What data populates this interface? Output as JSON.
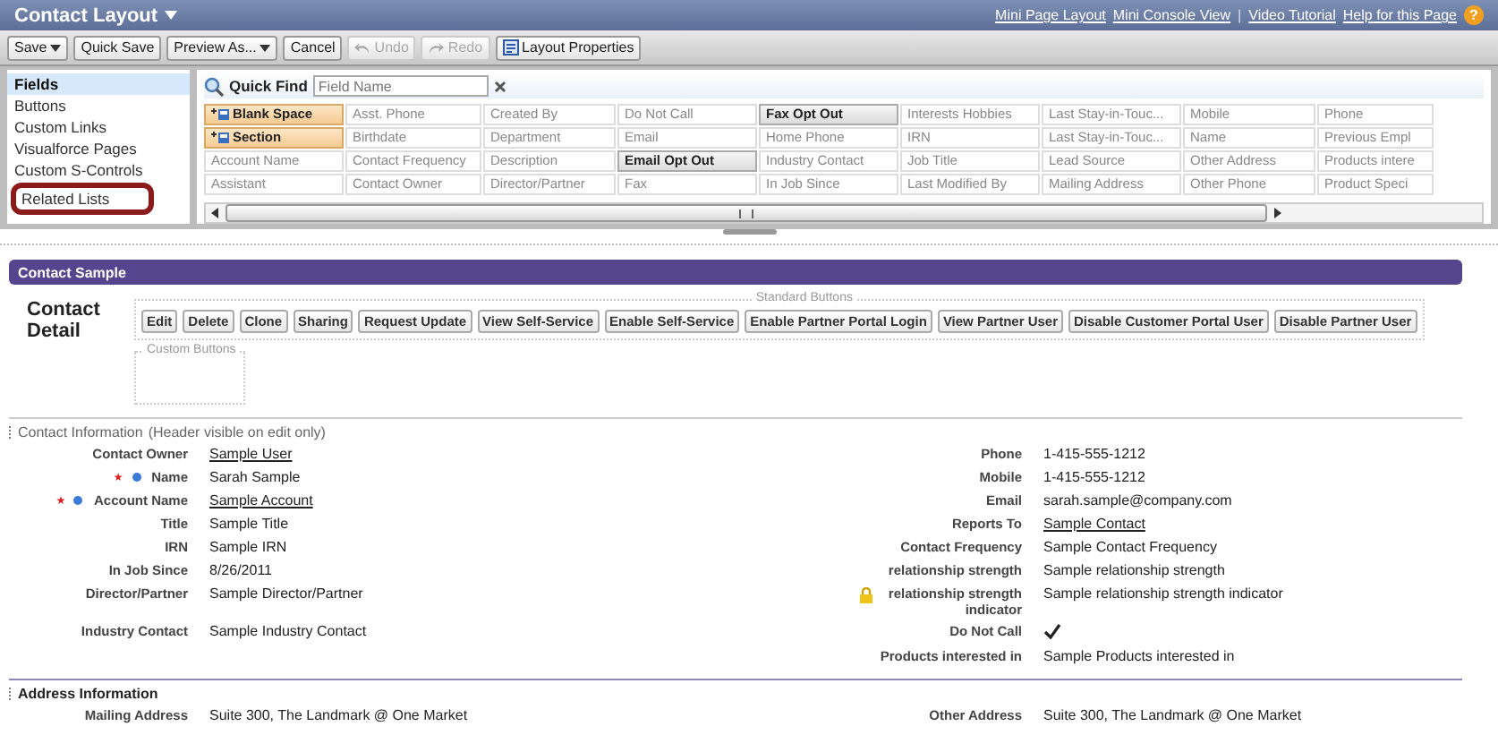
{
  "header": {
    "title": "Contact Layout",
    "links": [
      "Mini Page Layout",
      "Mini Console View",
      "Video Tutorial",
      "Help for this Page"
    ],
    "separator": "|",
    "help_glyph": "?"
  },
  "toolbar": [
    {
      "label": "Save",
      "menu": true,
      "disabled": false
    },
    {
      "label": "Quick Save",
      "menu": false,
      "disabled": false
    },
    {
      "label": "Preview As...",
      "menu": true,
      "disabled": false
    },
    {
      "label": "Cancel",
      "menu": false,
      "disabled": false
    },
    {
      "label": "Undo",
      "menu": false,
      "disabled": true
    },
    {
      "label": "Redo",
      "menu": false,
      "disabled": true
    },
    {
      "label": "Layout Properties",
      "menu": false,
      "disabled": false
    }
  ],
  "sidebar": {
    "items": [
      {
        "label": "Fields",
        "selected": true,
        "circled": false
      },
      {
        "label": "Buttons",
        "selected": false,
        "circled": false
      },
      {
        "label": "Custom Links",
        "selected": false,
        "circled": false
      },
      {
        "label": "Visualforce Pages",
        "selected": false,
        "circled": false
      },
      {
        "label": "Custom S-Controls",
        "selected": false,
        "circled": false
      },
      {
        "label": "Related Lists",
        "selected": false,
        "circled": true
      }
    ]
  },
  "quick_find": {
    "label": "Quick Find",
    "placeholder": "Field Name"
  },
  "palette_rows": [
    [
      {
        "label": "Blank Space",
        "kind": "special",
        "placed": false
      },
      {
        "label": "Asst. Phone",
        "kind": "field",
        "placed": true
      },
      {
        "label": "Created By",
        "kind": "field",
        "placed": true
      },
      {
        "label": "Do Not Call",
        "kind": "field",
        "placed": true
      },
      {
        "label": "Fax Opt Out",
        "kind": "field",
        "placed": false
      },
      {
        "label": "Interests Hobbies",
        "kind": "field",
        "placed": true
      },
      {
        "label": "Last Stay-in-Touc...",
        "kind": "field",
        "placed": true
      },
      {
        "label": "Mobile",
        "kind": "field",
        "placed": true
      },
      {
        "label": "Phone",
        "kind": "field",
        "placed": true
      }
    ],
    [
      {
        "label": "Section",
        "kind": "special",
        "placed": false
      },
      {
        "label": "Birthdate",
        "kind": "field",
        "placed": true
      },
      {
        "label": "Department",
        "kind": "field",
        "placed": true
      },
      {
        "label": "Email",
        "kind": "field",
        "placed": true
      },
      {
        "label": "Home Phone",
        "kind": "field",
        "placed": true
      },
      {
        "label": "IRN",
        "kind": "field",
        "placed": true
      },
      {
        "label": "Last Stay-in-Touc...",
        "kind": "field",
        "placed": true
      },
      {
        "label": "Name",
        "kind": "field",
        "placed": true
      },
      {
        "label": "Previous Empl",
        "kind": "field",
        "placed": true
      }
    ],
    [
      {
        "label": "Account Name",
        "kind": "field",
        "placed": true
      },
      {
        "label": "Contact Frequency",
        "kind": "field",
        "placed": true
      },
      {
        "label": "Description",
        "kind": "field",
        "placed": true
      },
      {
        "label": "Email Opt Out",
        "kind": "field",
        "placed": false
      },
      {
        "label": "Industry Contact",
        "kind": "field",
        "placed": true
      },
      {
        "label": "Job Title",
        "kind": "field",
        "placed": true
      },
      {
        "label": "Lead Source",
        "kind": "field",
        "placed": true
      },
      {
        "label": "Other Address",
        "kind": "field",
        "placed": true
      },
      {
        "label": "Products intere",
        "kind": "field",
        "placed": true
      }
    ],
    [
      {
        "label": "Assistant",
        "kind": "field",
        "placed": true
      },
      {
        "label": "Contact Owner",
        "kind": "field",
        "placed": true
      },
      {
        "label": "Director/Partner",
        "kind": "field",
        "placed": true
      },
      {
        "label": "Fax",
        "kind": "field",
        "placed": true
      },
      {
        "label": "In Job Since",
        "kind": "field",
        "placed": true
      },
      {
        "label": "Last Modified By",
        "kind": "field",
        "placed": true
      },
      {
        "label": "Mailing Address",
        "kind": "field",
        "placed": true
      },
      {
        "label": "Other Phone",
        "kind": "field",
        "placed": true
      },
      {
        "label": "Product Speci",
        "kind": "field",
        "placed": true
      }
    ]
  ],
  "preview": {
    "title": "Contact Sample",
    "detail_title": "Contact Detail",
    "standard_buttons_legend": "Standard Buttons",
    "standard_buttons": [
      "Edit",
      "Delete",
      "Clone",
      "Sharing",
      "Request Update",
      "View Self-Service",
      "Enable Self-Service",
      "Enable Partner Portal Login",
      "View Partner User",
      "Disable Customer Portal User",
      "Disable Partner User"
    ],
    "custom_buttons_legend": "Custom Buttons"
  },
  "contact_section": {
    "title": "Contact Information",
    "note": "(Header visible on edit only)",
    "rows": [
      {
        "left": {
          "label": "Contact Owner",
          "value": "Sample User",
          "kind": "link"
        },
        "right": {
          "label": "Phone",
          "value": "1-415-555-1212",
          "kind": "text"
        }
      },
      {
        "left": {
          "label": "Name",
          "value": "Sarah Sample",
          "kind": "text",
          "required": true
        },
        "right": {
          "label": "Mobile",
          "value": "1-415-555-1212",
          "kind": "text"
        }
      },
      {
        "left": {
          "label": "Account Name",
          "value": "Sample Account",
          "kind": "link",
          "required": true
        },
        "right": {
          "label": "Email",
          "value": "sarah.sample@company.com",
          "kind": "text"
        }
      },
      {
        "left": {
          "label": "Title",
          "value": "Sample Title",
          "kind": "text"
        },
        "right": {
          "label": "Reports To",
          "value": "Sample Contact",
          "kind": "link"
        }
      },
      {
        "left": {
          "label": "IRN",
          "value": "Sample IRN",
          "kind": "text"
        },
        "right": {
          "label": "Contact Frequency",
          "value": "Sample Contact Frequency",
          "kind": "text"
        }
      },
      {
        "left": {
          "label": "In Job Since",
          "value": "8/26/2011",
          "kind": "text"
        },
        "right": {
          "label": "relationship strength",
          "value": "Sample relationship strength",
          "kind": "text"
        }
      },
      {
        "left": {
          "label": "Director/Partner",
          "value": "Sample Director/Partner",
          "kind": "text"
        },
        "right": {
          "label": "relationship strength indicator",
          "value": "Sample relationship strength indicator",
          "kind": "text",
          "locked": true
        }
      },
      {
        "left": {
          "label": "Industry Contact",
          "value": "Sample Industry Contact",
          "kind": "text"
        },
        "right": {
          "label": "Do Not Call",
          "checked": true,
          "kind": "checkbox"
        }
      },
      {
        "right": {
          "label": "Products interested in",
          "value": "Sample Products interested in",
          "kind": "text"
        }
      }
    ]
  },
  "address_section": {
    "title": "Address Information",
    "rows": [
      {
        "left": {
          "label": "Mailing Address",
          "value": "Suite 300, The Landmark @ One Market",
          "kind": "text"
        },
        "right": {
          "label": "Other Address",
          "value": "Suite 300, The Landmark @ One Market",
          "kind": "text"
        }
      }
    ]
  }
}
